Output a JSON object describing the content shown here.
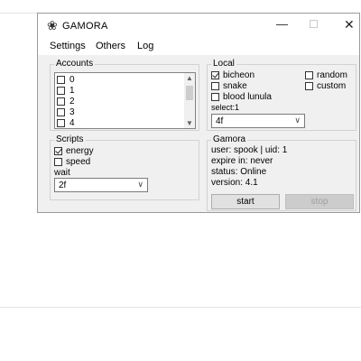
{
  "window": {
    "title": "GAMORA",
    "icon": "bug-icon",
    "controls": {
      "minimize": "—",
      "maximize": "☐",
      "close": "✕"
    }
  },
  "menu": [
    "Settings",
    "Others",
    "Log"
  ],
  "accounts": {
    "label": "Accounts",
    "items": [
      {
        "label": "0",
        "checked": false
      },
      {
        "label": "1",
        "checked": false
      },
      {
        "label": "2",
        "checked": false
      },
      {
        "label": "3",
        "checked": false
      },
      {
        "label": "4",
        "checked": false
      }
    ]
  },
  "local": {
    "label": "Local",
    "options": [
      {
        "label": "bicheon",
        "checked": true
      },
      {
        "label": "snake",
        "checked": false
      },
      {
        "label": "blood lunula",
        "checked": false
      }
    ],
    "extra_options": [
      {
        "label": "random",
        "checked": false
      },
      {
        "label": "custom",
        "checked": false
      }
    ],
    "select_label": "select:1",
    "select_value": "4f"
  },
  "scripts": {
    "label": "Scripts",
    "options": [
      {
        "label": "energy",
        "checked": true
      },
      {
        "label": "speed",
        "checked": false
      }
    ],
    "wait_label": "wait",
    "wait_value": "2f"
  },
  "gamora": {
    "label": "Gamora",
    "user_line": "user: spook | uid: 1",
    "expire_line": "expire in: never",
    "status_line": "status: Online",
    "version_line": "version: 4.1",
    "start_label": "start",
    "stop_label": "stop"
  },
  "colors": {
    "window_bg": "#f0f0f0",
    "titlebar_bg": "#ffffff",
    "disabled_button": "#cccccc"
  }
}
